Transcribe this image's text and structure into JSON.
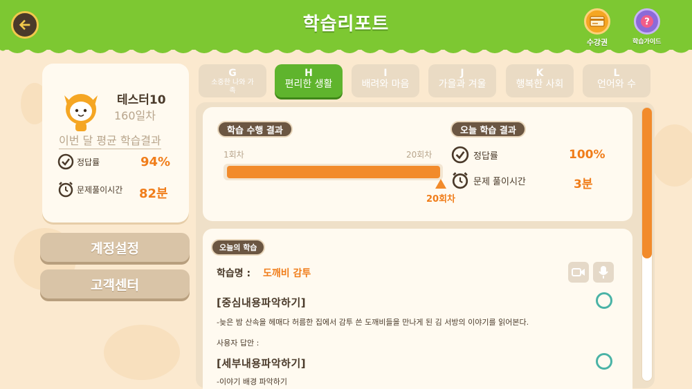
{
  "header": {
    "title": "학습리포트",
    "ticket_label": "수강권",
    "guide_label": "학습가이드"
  },
  "profile": {
    "name": "테스터10",
    "days": "160일차",
    "month_avg_title": "이번 달 평균 학습결과",
    "accuracy_label": "정답률",
    "accuracy_value": "94%",
    "time_label": "문제풀이시간",
    "time_value": "82분"
  },
  "side_buttons": {
    "account": "계정설정",
    "support": "고객센터"
  },
  "tabs": [
    {
      "key": "G",
      "title": "소중한 나와 가족",
      "active": false
    },
    {
      "key": "H",
      "title": "편리한 생활",
      "active": true
    },
    {
      "key": "I",
      "title": "배려와 마음",
      "active": false
    },
    {
      "key": "J",
      "title": "가을과 겨울",
      "active": false
    },
    {
      "key": "K",
      "title": "행복한 사회",
      "active": false
    },
    {
      "key": "L",
      "title": "언어와 수",
      "active": false
    }
  ],
  "progress": {
    "title": "학습 수행 결과",
    "start_label": "1회차",
    "end_label": "20회차",
    "current_label": "20회차",
    "fraction": 1.0
  },
  "today": {
    "title": "오늘 학습 결과",
    "accuracy_label": "정답률",
    "accuracy_value": "100%",
    "time_label": "문제 풀이시간",
    "time_value": "3분"
  },
  "study": {
    "pill": "오늘의 학습",
    "name_label": "학습명 :",
    "name_value": "도깨비 감투",
    "section1_title": "[중심내용파악하기]",
    "section1_desc": "-늦은 밤 산속을 헤매다 허름한 집에서 감투 쓴 도깨비들을 만나게 된 김 서방의 이야기를 읽어본다.",
    "answer_label": "사용자 답안 :",
    "section2_title": "[세부내용파악하기]",
    "section2_desc": "-이야기 배경 파악하기"
  },
  "colors": {
    "header_green": "#7dc832",
    "accent_orange": "#f28b2b",
    "active_tab": "#5fb42d",
    "ring_teal": "#4ab3a6"
  }
}
